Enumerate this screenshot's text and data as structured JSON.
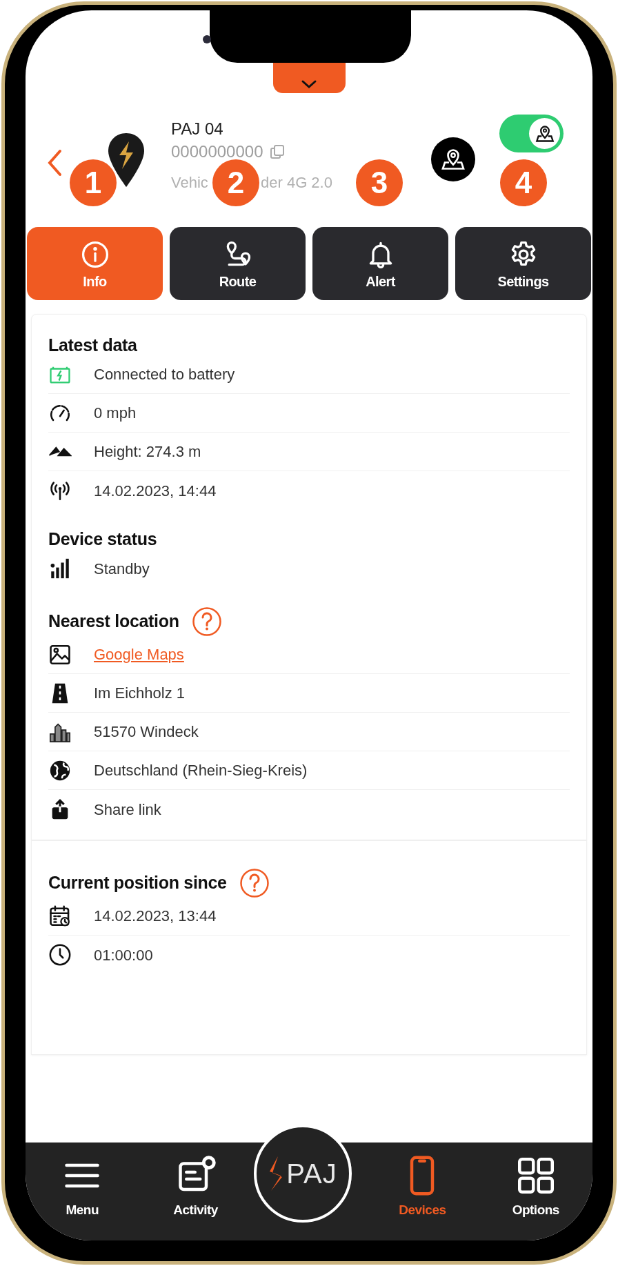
{
  "device": {
    "name": "PAJ 04",
    "number": "0000000000",
    "model": [
      "Vehic",
      "der 4G 2.0"
    ]
  },
  "map_toggle": {
    "on": true
  },
  "callouts": [
    "1",
    "2",
    "3",
    "4"
  ],
  "tabs": [
    {
      "label": "Info",
      "kind": "info",
      "selected": true
    },
    {
      "label": "Route",
      "kind": "route",
      "selected": false
    },
    {
      "label": "Alert",
      "kind": "alert",
      "selected": false
    },
    {
      "label": "Settings",
      "kind": "settings",
      "selected": false
    }
  ],
  "cards": [
    {
      "sections": [
        {
          "title": "Latest data",
          "help": false,
          "rows": [
            {
              "kind": "battery",
              "text": "Connected to battery"
            },
            {
              "kind": "speed",
              "text": "0 mph"
            },
            {
              "kind": "height",
              "text": "Height: 274.3 m"
            },
            {
              "kind": "signal",
              "text": "14.02.2023, 14:44"
            }
          ]
        },
        {
          "title": "Device status",
          "help": false,
          "rows": [
            {
              "kind": "bars",
              "text": "Standby"
            }
          ]
        },
        {
          "title": "Nearest location",
          "help": true,
          "rows": [
            {
              "kind": "map",
              "text": "Google Maps",
              "link": true
            },
            {
              "kind": "road",
              "text": "Im Eichholz 1"
            },
            {
              "kind": "city",
              "text": "51570 Windeck"
            },
            {
              "kind": "globe",
              "text": "Deutschland (Rhein-Sieg-Kreis)"
            },
            {
              "kind": "share",
              "text": "Share link"
            }
          ]
        }
      ]
    },
    {
      "sections": [
        {
          "title": "Current position since",
          "help": true,
          "rows": [
            {
              "kind": "calendar",
              "text": "14.02.2023, 13:44"
            },
            {
              "kind": "clock",
              "text": "01:00:00"
            }
          ]
        }
      ]
    }
  ],
  "nav": {
    "logo": "PAJ",
    "items": [
      {
        "label": "Menu",
        "kind": "menu",
        "selected": false
      },
      {
        "label": "Activity",
        "kind": "activity",
        "selected": false
      },
      {
        "label": "Devices",
        "kind": "devices",
        "selected": true
      },
      {
        "label": "Options",
        "kind": "options",
        "selected": false
      }
    ]
  }
}
